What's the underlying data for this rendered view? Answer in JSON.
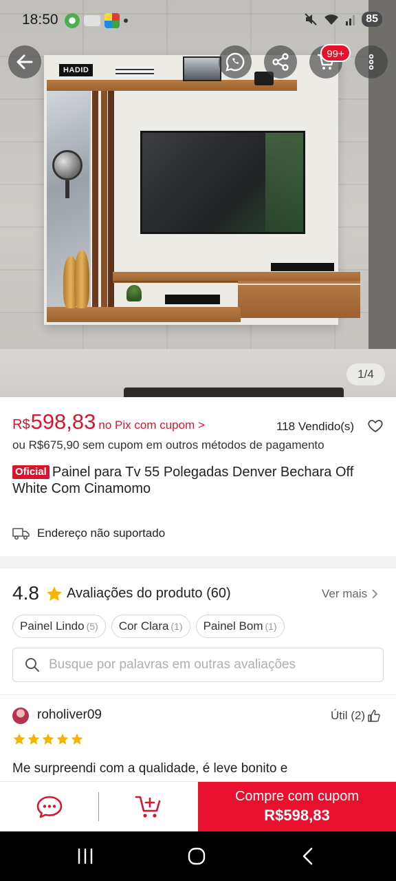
{
  "status_bar": {
    "time": "18:50",
    "battery": "85"
  },
  "hero": {
    "decor_label": "HADID",
    "image_counter": "1/4"
  },
  "toolbar": {
    "cart_badge": "99+"
  },
  "product": {
    "price_currency": "R$",
    "price_value": "598,83",
    "price_note": "no Pix com cupom >",
    "sold": "118 Vendido(s)",
    "alt_price": "ou R$675,90 sem cupom em outros métodos de pagamento",
    "official_badge": "Oficial",
    "title": "Painel para Tv 55 Polegadas Denver Bechara Off White Com Cinamomo"
  },
  "shipping": {
    "text": "Endereço não suportado"
  },
  "reviews": {
    "rating": "4.8",
    "title": "Avaliações do produto",
    "count": "(60)",
    "see_more": "Ver mais",
    "chips": [
      {
        "label": "Painel Lindo",
        "count": "(5)"
      },
      {
        "label": "Cor Clara",
        "count": "(1)"
      },
      {
        "label": "Painel Bom",
        "count": "(1)"
      }
    ],
    "search_placeholder": "Busque por palavras em outras avaliações",
    "first_review": {
      "user": "roholiver09",
      "useful": "Útil (2)",
      "stars": 5,
      "text": "Me surpreendi com a qualidade, é leve bonito e"
    }
  },
  "action_bar": {
    "buy_line1": "Compre com cupom",
    "buy_line2": "R$598,83"
  },
  "colors": {
    "accent": "#e8102c",
    "price": "#d8152d",
    "star": "#f5b400"
  }
}
